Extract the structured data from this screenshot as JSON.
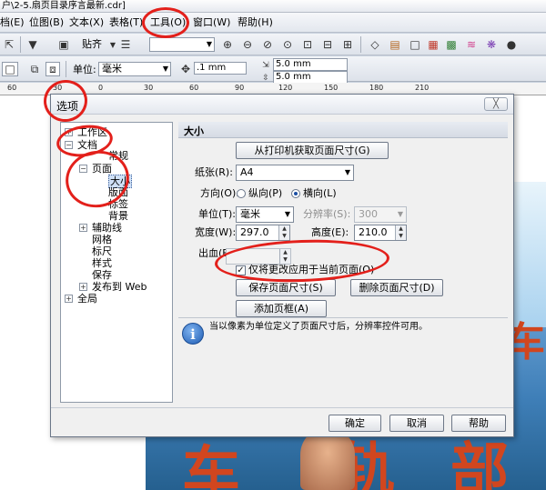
{
  "window": {
    "title": "户\\2-5.扇页目录序言最新.cdr]"
  },
  "menubar": {
    "items": [
      "档(E)",
      "位图(B)",
      "文本(X)",
      "表格(T)",
      "工具(O)",
      "窗口(W)",
      "帮助(H)"
    ]
  },
  "toolbar1": {
    "snap_label": "贴齐",
    "zoom_value": ""
  },
  "toolbar2": {
    "unit_label": "单位:",
    "unit_value": "毫米",
    "nudge_value": ".1 mm",
    "dup_x": "5.0 mm",
    "dup_y": "5.0 mm"
  },
  "ruler": {
    "ticks": [
      "60",
      "30",
      "0",
      "30",
      "60",
      "90",
      "120",
      "150",
      "180",
      "210"
    ]
  },
  "dialog": {
    "title": "选项",
    "close_label": "╳",
    "tree": {
      "workspace": "工作区",
      "document": "文档",
      "general": "常规",
      "page": "页面",
      "size": "大小",
      "layout": "版面",
      "label": "标签",
      "background": "背景",
      "guidelines": "辅助线",
      "grid": "网格",
      "rulers": "标尺",
      "styles": "样式",
      "save": "保存",
      "publish_web": "发布到 Web",
      "global": "全局"
    },
    "panel": {
      "header": "大小",
      "from_printer_button": "从打印机获取页面尺寸(G)",
      "paper_label": "纸张(R):",
      "paper_value": "A4",
      "orientation_label": "方向(O):",
      "portrait_label": "纵向(P)",
      "landscape_label": "横向(L)",
      "units_label": "单位(T):",
      "units_value": "毫米",
      "resolution_label": "分辨率(S):",
      "resolution_value": "300",
      "width_label": "宽度(W):",
      "width_value": "297.0",
      "height_label": "高度(E):",
      "height_value": "210.0",
      "bleed_label": "出血(B)",
      "bleed_value": "",
      "apply_current_label": "仅将更改应用于当前页面(O)",
      "apply_current_checked": true,
      "save_size_button": "保存页面尺寸(S)",
      "delete_size_button": "删除页面尺寸(D)",
      "add_frame_button": "添加页框(A)",
      "info_text": "当以像素为单位定义了页面尺寸后，分辨率控件可用。"
    },
    "footer": {
      "ok_button": "确定",
      "cancel_button": "取消",
      "help_button": "帮助"
    }
  },
  "canvas": {
    "calligraphy_1": "车",
    "calligraphy_2": "轨",
    "calligraphy_3": "部"
  },
  "colors": {
    "annotation": "#e3201b",
    "accent": "#1d5bb3"
  }
}
